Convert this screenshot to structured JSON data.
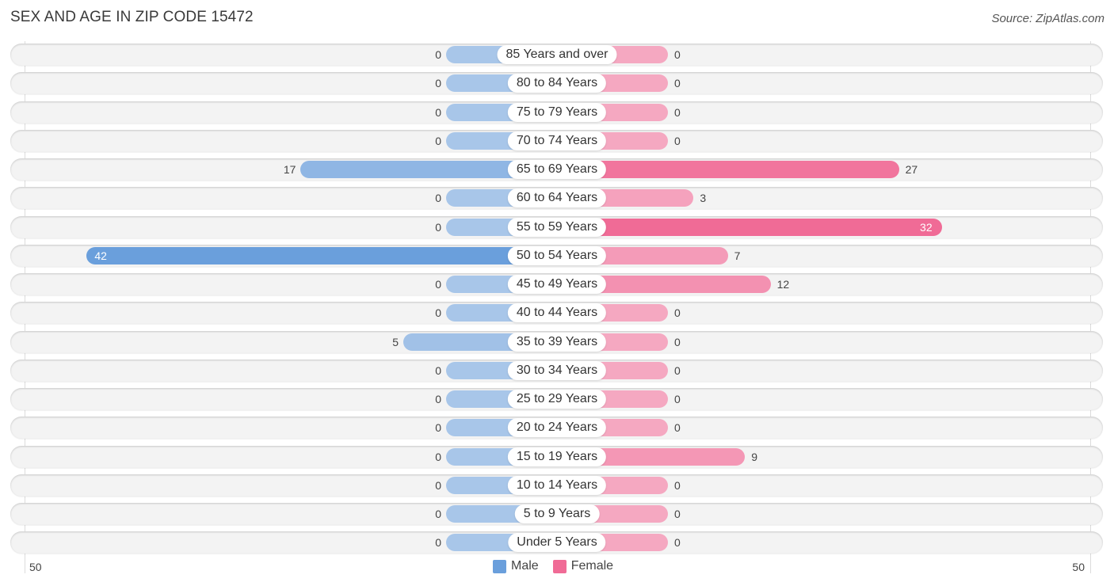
{
  "chart_data": {
    "type": "bar",
    "orientation": "horizontal-diverging",
    "title": "SEX AND AGE IN ZIP CODE 15472",
    "source": "Source: ZipAtlas.com",
    "categories": [
      "85 Years and over",
      "80 to 84 Years",
      "75 to 79 Years",
      "70 to 74 Years",
      "65 to 69 Years",
      "60 to 64 Years",
      "55 to 59 Years",
      "50 to 54 Years",
      "45 to 49 Years",
      "40 to 44 Years",
      "35 to 39 Years",
      "30 to 34 Years",
      "25 to 29 Years",
      "20 to 24 Years",
      "15 to 19 Years",
      "10 to 14 Years",
      "5 to 9 Years",
      "Under 5 Years"
    ],
    "series": [
      {
        "name": "Male",
        "color": "#6a9fdc",
        "values": [
          0,
          0,
          0,
          0,
          17,
          0,
          0,
          42,
          0,
          0,
          5,
          0,
          0,
          0,
          0,
          0,
          0,
          0
        ]
      },
      {
        "name": "Female",
        "color": "#f06b96",
        "values": [
          0,
          0,
          0,
          0,
          27,
          3,
          32,
          7,
          12,
          0,
          0,
          0,
          0,
          0,
          9,
          0,
          0,
          0
        ]
      }
    ],
    "axis": {
      "left_tick": "50",
      "right_tick": "50",
      "range": [
        0,
        50
      ]
    },
    "legend": {
      "position": "bottom-center",
      "entries": [
        "Male",
        "Female"
      ]
    }
  }
}
